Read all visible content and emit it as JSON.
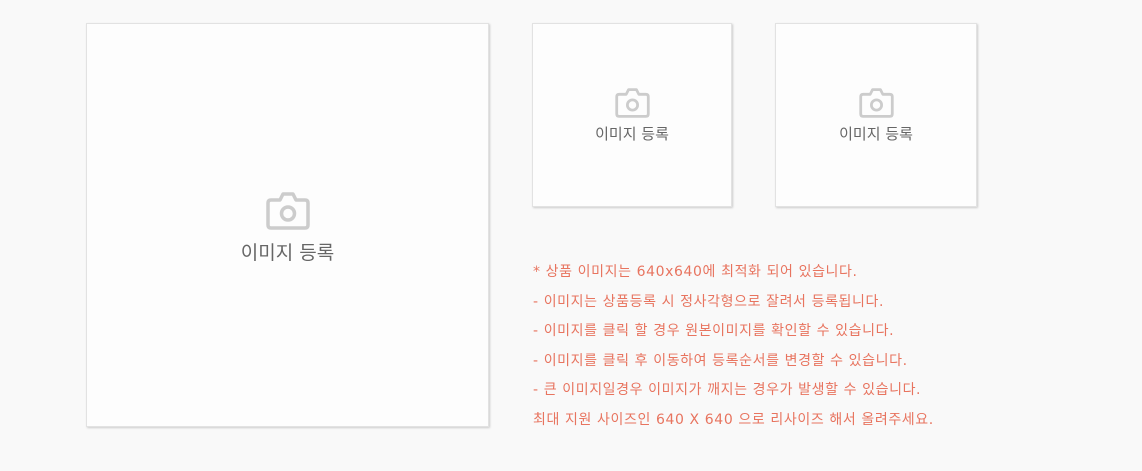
{
  "upload": {
    "main_label": "이미지 등록",
    "sub1_label": "이미지 등록",
    "sub2_label": "이미지 등록",
    "icon": "camera-icon"
  },
  "notes": [
    "* 상품 이미지는 640x640에 최적화 되어 있습니다.",
    "- 이미지는 상품등록 시 정사각형으로 잘려서 등록됩니다.",
    "- 이미지를 클릭 할 경우 원본이미지를 확인할 수 있습니다.",
    "- 이미지를 클릭 후 이동하여 등록순서를 변경할 수 있습니다.",
    "- 큰 이미지일경우 이미지가 깨지는 경우가 발생할 수 있습니다.",
    "최대 지원 사이즈인 640 X 640 으로 리사이즈 해서 올려주세요."
  ],
  "colors": {
    "icon": "#cccccc",
    "label": "#666666",
    "notes": "#e8745f"
  }
}
